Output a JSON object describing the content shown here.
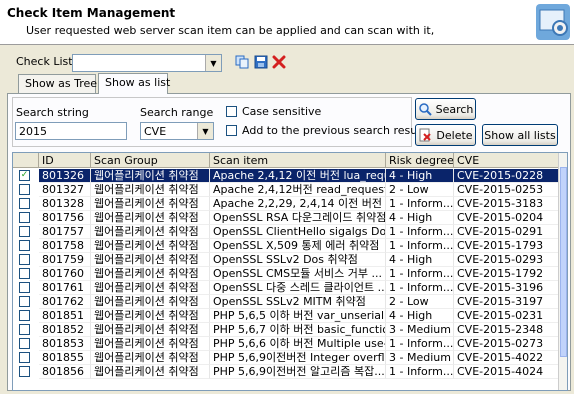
{
  "header": {
    "title": "Check Item Management",
    "subtitle": "User requested web server scan item can be applied and can scan with it,"
  },
  "toolbar": {
    "check_list_label": "Check List",
    "check_list_value": "",
    "icons": [
      "copy-icon",
      "save-icon",
      "delete-x-icon"
    ]
  },
  "tabs": [
    {
      "label": "Show as Tree",
      "active": false
    },
    {
      "label": "Show as list",
      "active": true
    }
  ],
  "search": {
    "string_label": "Search string",
    "string_value": "2015",
    "range_label": "Search range",
    "range_value": "CVE",
    "case_sensitive_label": "Case sensitive",
    "add_previous_label": "Add to the previous search result",
    "search_button": "Search",
    "delete_button": "Delete",
    "show_all_button": "Show all lists"
  },
  "table": {
    "columns": [
      "ID",
      "Scan Group",
      "Scan item",
      "Risk degree",
      "CVE"
    ],
    "rows": [
      {
        "checked": true,
        "selected": true,
        "id": "801326",
        "group": "웹어플리케이션 취약점",
        "item": "Apache 2,4,12 이전 버전 lua_requ...",
        "risk": "4 - High",
        "cve": "CVE-2015-0228"
      },
      {
        "checked": false,
        "id": "801327",
        "group": "웹어플리케이션 취약점",
        "item": "Apache 2,4,12버전 read_request_l...",
        "risk": "2 - Low",
        "cve": "CVE-2015-0253"
      },
      {
        "checked": false,
        "id": "801328",
        "group": "웹어플리케이션 취약점",
        "item": "Apache 2,2,29, 2,4,14 이전 버전 c...",
        "risk": "1 - Inform...",
        "cve": "CVE-2015-3183"
      },
      {
        "checked": false,
        "id": "801756",
        "group": "웹어플리케이션 취약점",
        "item": "OpenSSL RSA 다운그레이드 취약점",
        "risk": "4 - High",
        "cve": "CVE-2015-0204"
      },
      {
        "checked": false,
        "id": "801757",
        "group": "웹어플리케이션 취약점",
        "item": "OpenSSL ClientHello sigalgs DoS...",
        "risk": "1 - Inform...",
        "cve": "CVE-2015-0291"
      },
      {
        "checked": false,
        "id": "801758",
        "group": "웹어플리케이션 취약점",
        "item": "OpenSSL X,509 통제 에러 취약점",
        "risk": "1 - Inform...",
        "cve": "CVE-2015-1793"
      },
      {
        "checked": false,
        "id": "801759",
        "group": "웹어플리케이션 취약점",
        "item": "OpenSSL SSLv2 Dos 취약점",
        "risk": "4 - High",
        "cve": "CVE-2015-0293"
      },
      {
        "checked": false,
        "id": "801760",
        "group": "웹어플리케이션 취약점",
        "item": "OpenSSL CMS모듈 서비스 거부 ...",
        "risk": "1 - Inform...",
        "cve": "CVE-2015-1792"
      },
      {
        "checked": false,
        "id": "801761",
        "group": "웹어플리케이션 취약점",
        "item": "OpenSSL 다중 스레드 클라이언트 ...",
        "risk": "1 - Inform...",
        "cve": "CVE-2015-3196"
      },
      {
        "checked": false,
        "id": "801762",
        "group": "웹어플리케이션 취약점",
        "item": "OpenSSL SSLv2 MITM 취약점",
        "risk": "2 - Low",
        "cve": "CVE-2015-3197"
      },
      {
        "checked": false,
        "id": "801851",
        "group": "웹어플리케이션 취약점",
        "item": "PHP 5,6,5 이하 버전 var_unseriali...",
        "risk": "4 - High",
        "cve": "CVE-2015-0231"
      },
      {
        "checked": false,
        "id": "801852",
        "group": "웹어플리케이션 취약점",
        "item": "PHP 5,6,7 이하 버전 basic_functio...",
        "risk": "3 - Medium",
        "cve": "CVE-2015-2348"
      },
      {
        "checked": false,
        "id": "801853",
        "group": "웹어플리케이션 취약점",
        "item": "PHP 5,6,6 이하 버전 Multiple use-...",
        "risk": "1 - Inform...",
        "cve": "CVE-2015-0273"
      },
      {
        "checked": false,
        "id": "801855",
        "group": "웹어플리케이션 취약점",
        "item": "PHP 5,6,9이전버전 Integer overflo...",
        "risk": "3 - Medium",
        "cve": "CVE-2015-4022"
      },
      {
        "checked": false,
        "id": "801856",
        "group": "웹어플리케이션 취약점",
        "item": "PHP 5,6,9이전버전 알고리즘 복잡...",
        "risk": "1 - Inform...",
        "cve": "CVE-2015-4024"
      }
    ]
  }
}
